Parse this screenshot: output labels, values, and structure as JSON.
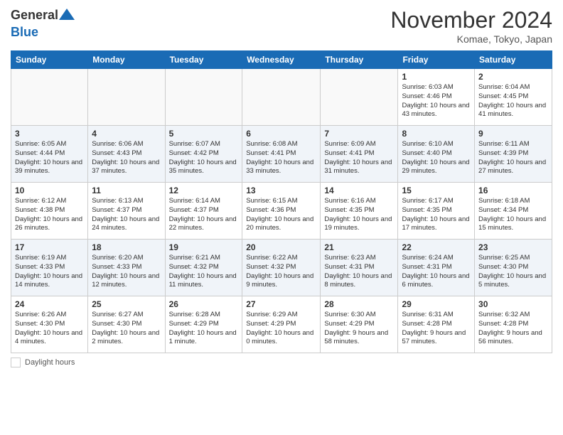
{
  "logo": {
    "general": "General",
    "blue": "Blue"
  },
  "title": "November 2024",
  "subtitle": "Komae, Tokyo, Japan",
  "headers": [
    "Sunday",
    "Monday",
    "Tuesday",
    "Wednesday",
    "Thursday",
    "Friday",
    "Saturday"
  ],
  "footer_label": "Daylight hours",
  "weeks": [
    [
      {
        "day": "",
        "info": ""
      },
      {
        "day": "",
        "info": ""
      },
      {
        "day": "",
        "info": ""
      },
      {
        "day": "",
        "info": ""
      },
      {
        "day": "",
        "info": ""
      },
      {
        "day": "1",
        "info": "Sunrise: 6:03 AM\nSunset: 4:46 PM\nDaylight: 10 hours and 43 minutes."
      },
      {
        "day": "2",
        "info": "Sunrise: 6:04 AM\nSunset: 4:45 PM\nDaylight: 10 hours and 41 minutes."
      }
    ],
    [
      {
        "day": "3",
        "info": "Sunrise: 6:05 AM\nSunset: 4:44 PM\nDaylight: 10 hours and 39 minutes."
      },
      {
        "day": "4",
        "info": "Sunrise: 6:06 AM\nSunset: 4:43 PM\nDaylight: 10 hours and 37 minutes."
      },
      {
        "day": "5",
        "info": "Sunrise: 6:07 AM\nSunset: 4:42 PM\nDaylight: 10 hours and 35 minutes."
      },
      {
        "day": "6",
        "info": "Sunrise: 6:08 AM\nSunset: 4:41 PM\nDaylight: 10 hours and 33 minutes."
      },
      {
        "day": "7",
        "info": "Sunrise: 6:09 AM\nSunset: 4:41 PM\nDaylight: 10 hours and 31 minutes."
      },
      {
        "day": "8",
        "info": "Sunrise: 6:10 AM\nSunset: 4:40 PM\nDaylight: 10 hours and 29 minutes."
      },
      {
        "day": "9",
        "info": "Sunrise: 6:11 AM\nSunset: 4:39 PM\nDaylight: 10 hours and 27 minutes."
      }
    ],
    [
      {
        "day": "10",
        "info": "Sunrise: 6:12 AM\nSunset: 4:38 PM\nDaylight: 10 hours and 26 minutes."
      },
      {
        "day": "11",
        "info": "Sunrise: 6:13 AM\nSunset: 4:37 PM\nDaylight: 10 hours and 24 minutes."
      },
      {
        "day": "12",
        "info": "Sunrise: 6:14 AM\nSunset: 4:37 PM\nDaylight: 10 hours and 22 minutes."
      },
      {
        "day": "13",
        "info": "Sunrise: 6:15 AM\nSunset: 4:36 PM\nDaylight: 10 hours and 20 minutes."
      },
      {
        "day": "14",
        "info": "Sunrise: 6:16 AM\nSunset: 4:35 PM\nDaylight: 10 hours and 19 minutes."
      },
      {
        "day": "15",
        "info": "Sunrise: 6:17 AM\nSunset: 4:35 PM\nDaylight: 10 hours and 17 minutes."
      },
      {
        "day": "16",
        "info": "Sunrise: 6:18 AM\nSunset: 4:34 PM\nDaylight: 10 hours and 15 minutes."
      }
    ],
    [
      {
        "day": "17",
        "info": "Sunrise: 6:19 AM\nSunset: 4:33 PM\nDaylight: 10 hours and 14 minutes."
      },
      {
        "day": "18",
        "info": "Sunrise: 6:20 AM\nSunset: 4:33 PM\nDaylight: 10 hours and 12 minutes."
      },
      {
        "day": "19",
        "info": "Sunrise: 6:21 AM\nSunset: 4:32 PM\nDaylight: 10 hours and 11 minutes."
      },
      {
        "day": "20",
        "info": "Sunrise: 6:22 AM\nSunset: 4:32 PM\nDaylight: 10 hours and 9 minutes."
      },
      {
        "day": "21",
        "info": "Sunrise: 6:23 AM\nSunset: 4:31 PM\nDaylight: 10 hours and 8 minutes."
      },
      {
        "day": "22",
        "info": "Sunrise: 6:24 AM\nSunset: 4:31 PM\nDaylight: 10 hours and 6 minutes."
      },
      {
        "day": "23",
        "info": "Sunrise: 6:25 AM\nSunset: 4:30 PM\nDaylight: 10 hours and 5 minutes."
      }
    ],
    [
      {
        "day": "24",
        "info": "Sunrise: 6:26 AM\nSunset: 4:30 PM\nDaylight: 10 hours and 4 minutes."
      },
      {
        "day": "25",
        "info": "Sunrise: 6:27 AM\nSunset: 4:30 PM\nDaylight: 10 hours and 2 minutes."
      },
      {
        "day": "26",
        "info": "Sunrise: 6:28 AM\nSunset: 4:29 PM\nDaylight: 10 hours and 1 minute."
      },
      {
        "day": "27",
        "info": "Sunrise: 6:29 AM\nSunset: 4:29 PM\nDaylight: 10 hours and 0 minutes."
      },
      {
        "day": "28",
        "info": "Sunrise: 6:30 AM\nSunset: 4:29 PM\nDaylight: 9 hours and 58 minutes."
      },
      {
        "day": "29",
        "info": "Sunrise: 6:31 AM\nSunset: 4:28 PM\nDaylight: 9 hours and 57 minutes."
      },
      {
        "day": "30",
        "info": "Sunrise: 6:32 AM\nSunset: 4:28 PM\nDaylight: 9 hours and 56 minutes."
      }
    ]
  ]
}
